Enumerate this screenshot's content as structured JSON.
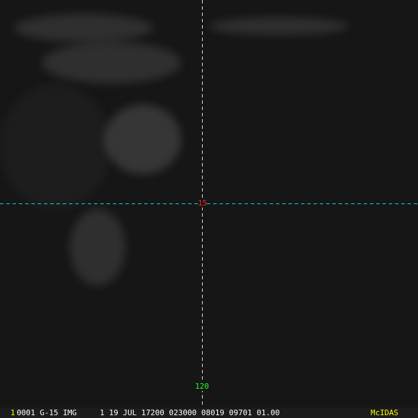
{
  "image": {
    "latitude_label": "15",
    "longitude_label": "120",
    "colors": {
      "latitude_line": "#00e0e0",
      "longitude_line": "#ffffff",
      "latitude_label": "#ff2020",
      "longitude_label": "#20ff20",
      "accent": "#ffff00"
    }
  },
  "status_bar": {
    "frame": "1",
    "fields": "0001 G-15 IMG     1 19 JUL 17200 023000 08019 09701 01.00",
    "brand": "McIDAS"
  }
}
